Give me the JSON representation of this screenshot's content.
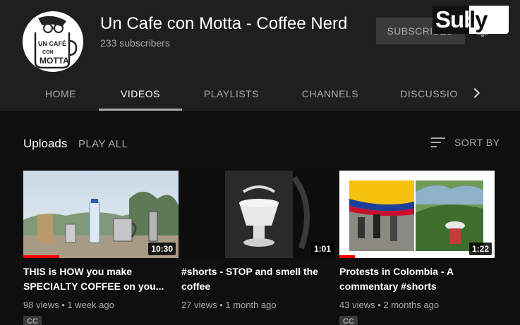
{
  "channel": {
    "title": "Un Cafe con Motta - Coffee Nerd",
    "subscribers": "233 subscribers",
    "avatar_text": "UN CAFÉ CON MOTTA",
    "subscribe_label": "SUBSCRIBED",
    "watermark": "Subly"
  },
  "tabs": [
    {
      "label": "HOME",
      "active": false
    },
    {
      "label": "VIDEOS",
      "active": true
    },
    {
      "label": "PLAYLISTS",
      "active": false
    },
    {
      "label": "CHANNELS",
      "active": false
    },
    {
      "label": "DISCUSSIO",
      "active": false
    }
  ],
  "section": {
    "title": "Uploads",
    "play_all": "PLAY ALL",
    "sort_label": "SORT BY"
  },
  "videos": [
    {
      "title": "THIS is HOW you make SPECIALTY COFFEE on you...",
      "meta": "98 views • 1 week ago",
      "duration": "10:30",
      "badge": "CC",
      "watched_fraction": 0.23
    },
    {
      "title": "#shorts - STOP and smell the coffee",
      "meta": "27 views • 1 month ago",
      "duration": "1:01",
      "badge": ""
    },
    {
      "title": "Protests in Colombia - A commentary #shorts",
      "meta": "43 views • 2 months ago",
      "duration": "1:22",
      "badge": "CC",
      "watched_fraction": 0.1
    }
  ],
  "colors": {
    "background": "#0f0f0f",
    "header": "#1f1f1f",
    "progress": "#ff0000",
    "text_secondary": "#aaaaaa"
  }
}
